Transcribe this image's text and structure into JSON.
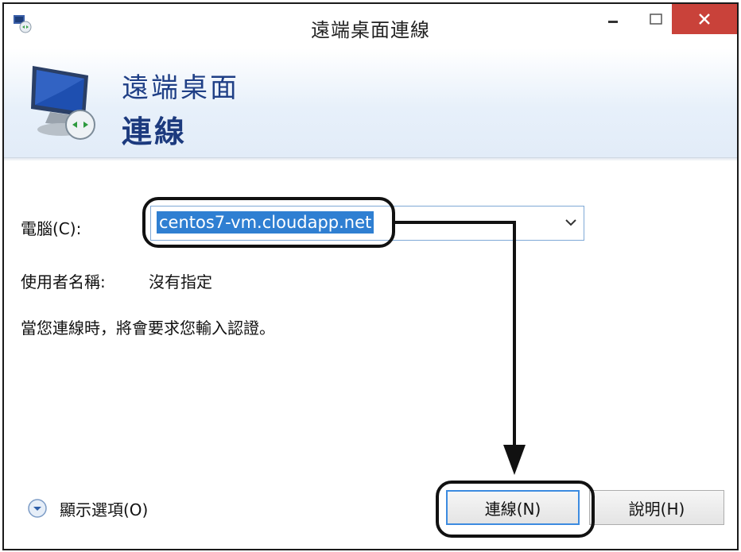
{
  "window": {
    "title": "遠端桌面連線",
    "minimize_glyph": "—",
    "maximize_glyph": "☐",
    "close_glyph": "✕"
  },
  "banner": {
    "line1": "遠端桌面",
    "line2": "連線"
  },
  "form": {
    "computer_label": "電腦(C):",
    "computer_value": "centos7-vm.cloudapp.net",
    "username_label": "使用者名稱:",
    "username_value": "沒有指定",
    "info_text": "當您連線時，將會要求您輸入認證。"
  },
  "footer": {
    "show_options_label": "顯示選項(O)",
    "connect_button": "連線(N)",
    "help_button": "說明(H)"
  },
  "icons": [
    "app-icon",
    "remote-desktop-monitor-icon",
    "dropdown-chevron-icon",
    "expand-options-icon"
  ],
  "colors": {
    "accent": "#2f7fd2",
    "close_button": "#c9423a",
    "banner_text": "#1f3f86"
  }
}
